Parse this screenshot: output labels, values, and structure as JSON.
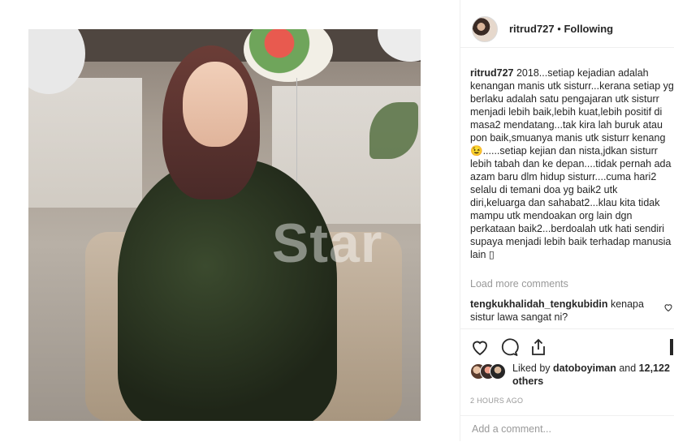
{
  "post": {
    "username": "ritrud727",
    "separator": "•",
    "follow_status": "Following",
    "watermark": "Star"
  },
  "caption": {
    "username": "ritrud727",
    "text": "2018...setiap kejadian adalah kenangan manis utk sisturr...kerana setiap yg berlaku adalah satu pengajaran utk sisturr menjadi lebih baik,lebih kuat,lebih positif di masa2 mendatang...tak kira lah buruk atau pon baik,smuanya manis utk sisturr kenang 😉......setiap kejian dan nista,jdkan sisturr lebih tabah dan ke depan....tidak pernah ada azam baru dlm hidup sisturr....cuma hari2 selalu di temani doa yg baik2 utk diri,keluarga dan sahabat2...klau kita tidak mampu utk mendoakan org lain dgn perkataan baik2...berdoalah utk hati sendiri supaya menjadi lebih baik terhadap manusia lain ▯"
  },
  "load_more": "Load more comments",
  "comment": {
    "username": "tengkukhalidah_tengkubidin",
    "text": "kenapa sistur lawa sangat ni?"
  },
  "likes": {
    "prefix": "Liked by",
    "user": "datoboyiman",
    "and": "and",
    "others": "12,122 others"
  },
  "timestamp": "2 HOURS AGO",
  "add_comment": {
    "placeholder": "Add a comment..."
  },
  "icons": {
    "like": "heart-icon",
    "comment": "comment-icon",
    "share": "share-icon",
    "comment_like": "heart-icon"
  }
}
